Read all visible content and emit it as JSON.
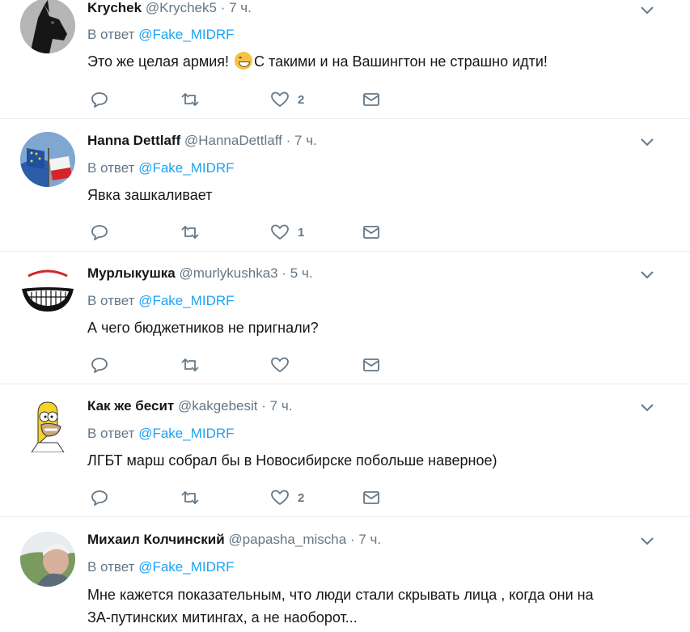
{
  "tweets": [
    {
      "name": "Krychek",
      "handle": "@Krychek5",
      "dot": "·",
      "time": "7 ч.",
      "reply_prefix": "В ответ",
      "reply_mention": "@Fake_MIDRF",
      "text_before_emoji": "Это же  целая армия! ",
      "emoji": "grinning-face-emoji",
      "text_after_emoji": "С такими и на Вашингтон не страшно идти!",
      "likes": "2"
    },
    {
      "name": "Hanna Dettlaff",
      "handle": "@HannaDettlaff",
      "dot": "·",
      "time": "7 ч.",
      "reply_prefix": "В ответ",
      "reply_mention": "@Fake_MIDRF",
      "text": "Явка зашкаливает",
      "likes": "1"
    },
    {
      "name": "Мурлыкушка",
      "handle": "@murlykushka3",
      "dot": "·",
      "time": "5 ч.",
      "reply_prefix": "В ответ",
      "reply_mention": "@Fake_MIDRF",
      "text": "А чего бюджетников не пригнали?",
      "likes": ""
    },
    {
      "name": "Как же бесит",
      "handle": "@kakgebesit",
      "dot": "·",
      "time": "7 ч.",
      "reply_prefix": "В ответ",
      "reply_mention": "@Fake_MIDRF",
      "text": "ЛГБТ марш собрал бы в Новосибирске побольше наверное)",
      "likes": "2"
    },
    {
      "name": "Михаил Колчинский",
      "handle": "@papasha_mischa",
      "dot": "·",
      "time": "7 ч.",
      "reply_prefix": "В ответ",
      "reply_mention": "@Fake_MIDRF",
      "text_line1": "Мне кажется показательным, что люди стали скрывать лица , когда они на",
      "text_line2": "ЗА-путинских митингах, а не наоборот..."
    }
  ],
  "icons": {
    "reply": "reply-icon",
    "retweet": "retweet-icon",
    "like": "heart-icon",
    "dm": "envelope-icon",
    "more": "chevron-down-icon"
  },
  "colors": {
    "mention": "#1da1f2",
    "secondary": "#657786",
    "divider": "#e6ecf0"
  }
}
